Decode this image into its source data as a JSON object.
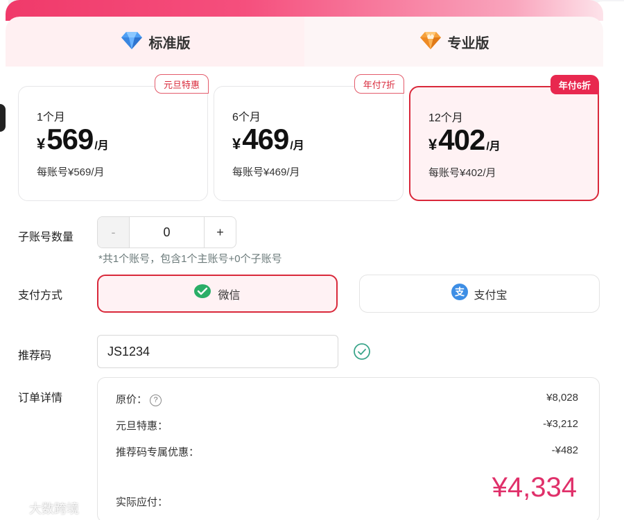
{
  "tabs": {
    "standard": {
      "label": "标准版",
      "icon": "blue-diamond-icon"
    },
    "pro": {
      "label": "专业版",
      "icon": "orange-diamond-icon"
    }
  },
  "plans": [
    {
      "period": "1个月",
      "currency": "¥",
      "price": "569",
      "per": "/月",
      "sub": "每账号¥569/月",
      "badge": "元旦特惠",
      "selected": false
    },
    {
      "period": "6个月",
      "currency": "¥",
      "price": "469",
      "per": "/月",
      "sub": "每账号¥469/月",
      "badge": "年付7折",
      "selected": false
    },
    {
      "period": "12个月",
      "currency": "¥",
      "price": "402",
      "per": "/月",
      "sub": "每账号¥402/月",
      "badge": "年付6折",
      "selected": true
    }
  ],
  "sub_accounts": {
    "label": "子账号数量",
    "minus": "-",
    "value": "0",
    "plus": "+",
    "hint": "*共1个账号，包含1个主账号+0个子账号"
  },
  "payment": {
    "label": "支付方式",
    "wechat": "微信",
    "alipay": "支付宝",
    "selected": "wechat"
  },
  "referral": {
    "label": "推荐码",
    "value": "JS1234"
  },
  "order": {
    "label": "订单详情",
    "original_label": "原价：",
    "original_value": "¥8,028",
    "promo_label": "元旦特惠：",
    "promo_value": "-¥3,212",
    "ref_label": "推荐码专属优惠：",
    "ref_value": "-¥482",
    "total_label": "实际应付：",
    "total_value": "¥4,334"
  },
  "watermark": "大数跨境",
  "colors": {
    "accent": "#d9283a",
    "total": "#e0306a",
    "badge_solid": "#e8284f",
    "wechat_green": "#2aae67",
    "alipay_blue": "#3d8ee5"
  }
}
